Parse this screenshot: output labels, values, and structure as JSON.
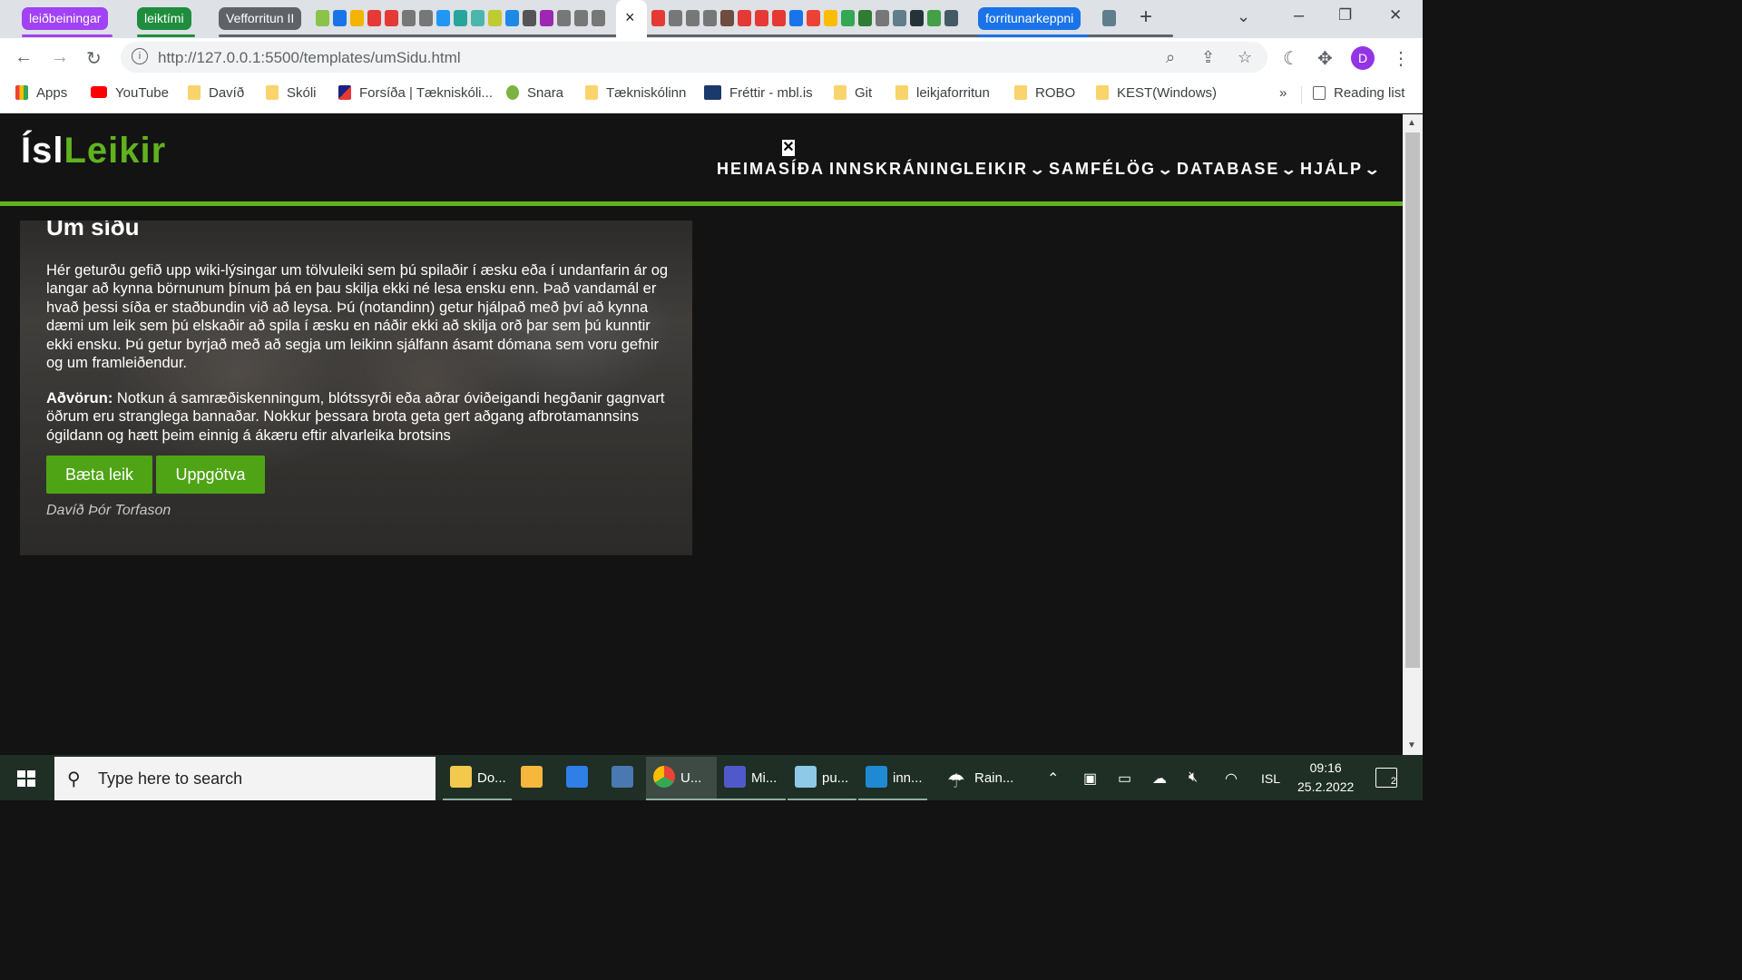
{
  "tab_strip": {
    "groups": [
      {
        "label": "leiðbeiningar",
        "color": "#a142f4"
      },
      {
        "label": "leiktími",
        "color": "#1e8e3e"
      },
      {
        "label": "Vefforritun II",
        "color": "#5f6368"
      },
      {
        "label": "forritunarkeppni",
        "color": "#1a73e8"
      }
    ],
    "active_tab_close": "×",
    "new_tab": "+",
    "window_controls": {
      "tab_search": "⌄",
      "minimize": "–",
      "restore": "❐",
      "close": "✕"
    }
  },
  "toolbar": {
    "url": "http://127.0.0.1:5500/templates/umSidu.html",
    "icons": [
      "back-icon",
      "forward-icon",
      "reload-icon",
      "zoom-icon",
      "share-icon",
      "star-icon",
      "extension-icon",
      "puzzle-icon",
      "menu-icon"
    ],
    "profile_initial": "D"
  },
  "bookmarks": {
    "items": [
      {
        "label": "Apps",
        "icon": "apps-grid-icon"
      },
      {
        "label": "YouTube",
        "icon": "youtube-icon"
      },
      {
        "label": "Davíð",
        "icon": "folder-icon"
      },
      {
        "label": "Skóli",
        "icon": "folder-icon"
      },
      {
        "label": "Forsíða | Tækniskóli...",
        "icon": "tskoli-icon"
      },
      {
        "label": "Snara",
        "icon": "snara-icon"
      },
      {
        "label": "Tækniskólinn",
        "icon": "folder-icon"
      },
      {
        "label": "Fréttir - mbl.is",
        "icon": "mbl-icon"
      },
      {
        "label": "Git",
        "icon": "folder-icon"
      },
      {
        "label": "leikjaforritun",
        "icon": "folder-icon"
      },
      {
        "label": "ROBO",
        "icon": "folder-icon"
      },
      {
        "label": "KEST(Windows)",
        "icon": "folder-icon"
      }
    ],
    "overflow": "»",
    "reading_list": "Reading list"
  },
  "site": {
    "logo_white": "Ísl",
    "logo_green": "Leikir",
    "nav_close": "✕",
    "nav": [
      {
        "label": "HEIMASÍÐA",
        "dropdown": false
      },
      {
        "label": "INNSKRÁNING",
        "dropdown": false
      },
      {
        "label": "LEIKIR",
        "dropdown": true
      },
      {
        "label": "SAMFÉLÖG",
        "dropdown": true
      },
      {
        "label": "DATABASE",
        "dropdown": true
      },
      {
        "label": "HJÁLP",
        "dropdown": true
      }
    ],
    "accent_color": "#60b21f"
  },
  "about": {
    "title": "Um síðu",
    "paragraph1": "Hér geturðu gefið upp wiki-lýsingar um tölvuleiki sem þú spilaðir í æsku eða í undanfarin ár og langar að kynna börnunum þínum þá en þau skilja ekki né lesa ensku enn. Það vandamál er hvað þessi síða er staðbundin við að leysa. Þú (notandinn) getur hjálpað með því að kynna dæmi um leik sem þú elskaðir að spila í æsku en náðir ekki að skilja orð þar sem þú kunntir ekki ensku. Þú getur byrjað með að segja um leikinn sjálfann ásamt dómana sem voru gefnir og um framleiðendur.",
    "warning_label": "Aðvörun:",
    "warning_text": " Notkun á samræðiskenningum, blótssyrði eða aðrar óviðeigandi hegðanir gagnvart öðrum eru stranglega bannaðar. Nokkur þessara brota geta gert aðgang afbrotamannsins ógildann og hætt þeim einnig á ákæru eftir alvarleika brotsins",
    "button_add": "Bæta leik",
    "button_discover": "Uppgötva",
    "author": "Davíð Þór Torfason"
  },
  "taskbar": {
    "search_placeholder": "Type here to search",
    "apps": [
      {
        "label": "Do...",
        "icon": "file-explorer-icon"
      },
      {
        "label": "",
        "icon": "lock-app-icon"
      },
      {
        "label": "",
        "icon": "calendar-icon"
      },
      {
        "label": "",
        "icon": "calculator-icon"
      },
      {
        "label": "U...",
        "icon": "chrome-icon"
      },
      {
        "label": "Mi...",
        "icon": "teams-icon"
      },
      {
        "label": "pu...",
        "icon": "notepad-icon"
      },
      {
        "label": "inn...",
        "icon": "vscode-icon"
      }
    ],
    "weather": "Rain...",
    "language": "ISL",
    "time": "09:16",
    "date": "25.2.2022",
    "notifications": "2"
  }
}
